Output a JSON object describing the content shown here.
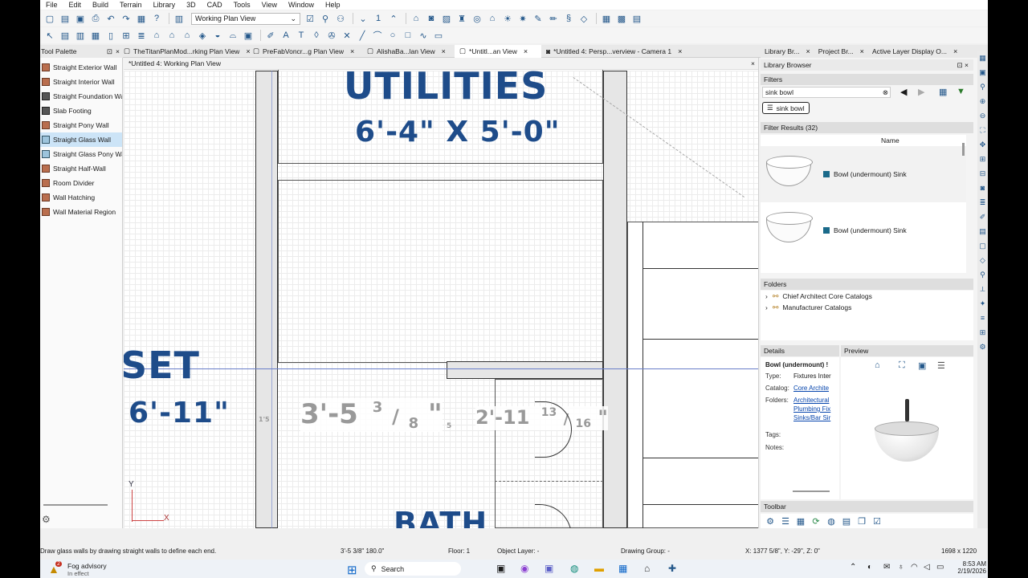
{
  "menu": [
    "File",
    "Edit",
    "Build",
    "Terrain",
    "Library",
    "3D",
    "CAD",
    "Tools",
    "View",
    "Window",
    "Help"
  ],
  "toolbar": {
    "view_select": "Working Plan View",
    "floor_num": "1"
  },
  "tabs": [
    {
      "label": "...",
      "active": false
    },
    {
      "label": "TheTitanPlanMod...rking Plan View",
      "active": false
    },
    {
      "label": "PreFabVoncr...g Plan View",
      "active": false
    },
    {
      "label": "AlishaBa...lan View",
      "active": false
    },
    {
      "label": "*Untitl...an View",
      "active": true
    },
    {
      "label": "*Untitled 4: Persp...verview - Camera 1",
      "active": false
    }
  ],
  "palette": {
    "title": "Tool Palette",
    "items": [
      "Straight Exterior Wall",
      "Straight Interior Wall",
      "Straight Foundation Wa",
      "Slab Footing",
      "Straight Pony Wall",
      "Straight Glass Wall",
      "Straight Glass Pony Wall",
      "Straight Half-Wall",
      "Room Divider",
      "Wall Hatching",
      "Wall Material Region"
    ],
    "selected": 5
  },
  "canvas": {
    "title": "*Untitled 4:  Working Plan View",
    "room1": "UTILITIES",
    "room1_size": "6'-4\" X 5'-0\"",
    "room2": "SET",
    "room2_size": "6'-11\"",
    "room3": "BATH",
    "dim1_main": "3'-5",
    "dim1_num": "3",
    "dim1_den": "8",
    "dim2_main": "2'-11",
    "dim2_num": "13",
    "dim2_den": "16",
    "axis_y": "Y",
    "axis_x": "X",
    "dim_small": "5",
    "dim_small2": "1'5"
  },
  "right_tabs": [
    "Library Br...",
    "Project Br...",
    "Active Layer Display O..."
  ],
  "library": {
    "title": "Library Browser",
    "filters_label": "Filters",
    "search_value": "sink bowl",
    "chip": "sink bowl",
    "results_label": "Filter Results (32)",
    "col_name": "Name",
    "results": [
      "Bowl (undermount) Sink",
      "Bowl (undermount) Sink"
    ],
    "folders_label": "Folders",
    "folders": [
      "Chief Architect Core Catalogs",
      "Manufacturer Catalogs"
    ],
    "details_label": "Details",
    "preview_label": "Preview",
    "det_title": "Bowl (undermount) !",
    "det_type_k": "Type:",
    "det_type_v": "Fixtures Inter",
    "det_catalog_k": "Catalog:",
    "det_catalog_v": "Core Archite",
    "det_folders_k": "Folders:",
    "det_folders_v1": "Architectural",
    "det_folders_v2": "Plumbing Fix",
    "det_folders_v3": "Sinks/Bar Sir",
    "det_tags_k": "Tags:",
    "det_notes_k": "Notes:",
    "toolbar_label": "Toolbar"
  },
  "status": {
    "hint": "Draw glass walls by drawing straight walls to define each end.",
    "dimension": "3'-5 3/8\" 180.0\"",
    "floor": "Floor: 1",
    "layer": "Object Layer: -",
    "group": "Drawing Group: -",
    "coords": "X: 1377 5/8\", Y: -29\", Z: 0\"",
    "screen": "1698 x 1220"
  },
  "taskbar": {
    "weather_title": "Fog advisory",
    "weather_sub": "In effect",
    "weather_badge": "2",
    "search": "Search",
    "time": "8:53 AM",
    "date": "2/19/2026"
  }
}
